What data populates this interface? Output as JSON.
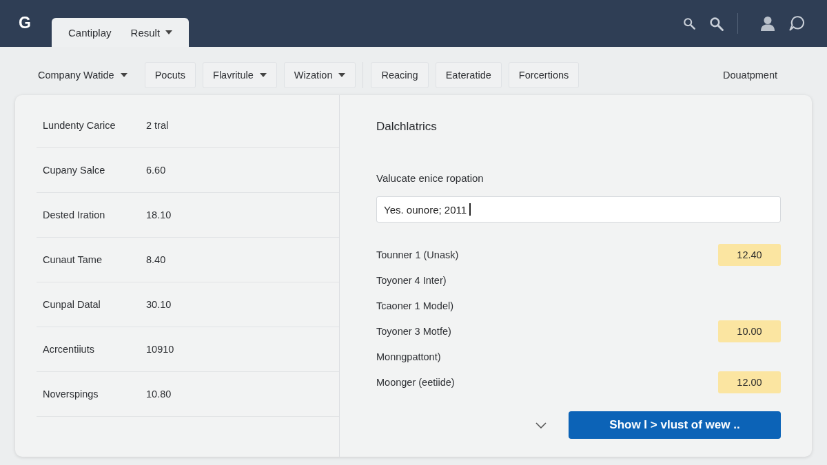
{
  "header": {
    "logo": "G",
    "tabs": [
      {
        "label": "Cantiplay",
        "menu": "Result",
        "selected": true
      }
    ]
  },
  "toolbar": {
    "groups": [
      {
        "items": [
          {
            "label": "Company Watide",
            "kind": "plain",
            "dropdown": true
          },
          {
            "label": "Pocuts",
            "kind": "chip",
            "dropdown": false
          },
          {
            "label": "Flavritule",
            "kind": "chip",
            "dropdown": true
          },
          {
            "label": "Wization",
            "kind": "chip",
            "dropdown": true
          }
        ]
      },
      {
        "items": [
          {
            "label": "Reacing",
            "kind": "chip",
            "dropdown": false
          },
          {
            "label": "Eateratide",
            "kind": "chip",
            "dropdown": false
          },
          {
            "label": "Forcertions",
            "kind": "chip",
            "dropdown": false
          }
        ]
      }
    ],
    "end": {
      "label": "Douatpment",
      "kind": "plain",
      "dropdown": false
    }
  },
  "table": {
    "rows": [
      {
        "label": "Lundenty Carice",
        "value": "2 tral"
      },
      {
        "label": "Cupany Salce",
        "value": "6.60"
      },
      {
        "label": "Dested Iration",
        "value": "18.10"
      },
      {
        "label": "Cunaut Tame",
        "value": "8.40"
      },
      {
        "label": "Cunpal Datal",
        "value": "30.10"
      },
      {
        "label": "Acrcentiiuts",
        "value": "10910"
      },
      {
        "label": "Noverspings",
        "value": "10.80"
      }
    ]
  },
  "details": {
    "title": "Dalchlatrics",
    "field_label": "Valucate enice ropation",
    "field_value": "Yes. ounore; 2011",
    "items": [
      {
        "label": "Tounner 1 (Unask)",
        "value": "12.40"
      },
      {
        "label": "Toyoner 4 Inter)"
      },
      {
        "label": "Tcaoner 1 Model)"
      },
      {
        "label": "Toyoner 3 Motfe)",
        "value": "10.00"
      },
      {
        "label": "Monngpattont)"
      },
      {
        "label": "Moonger (eetiide)",
        "value": "12.00"
      }
    ],
    "button": "Show I > vlust of wew .."
  }
}
